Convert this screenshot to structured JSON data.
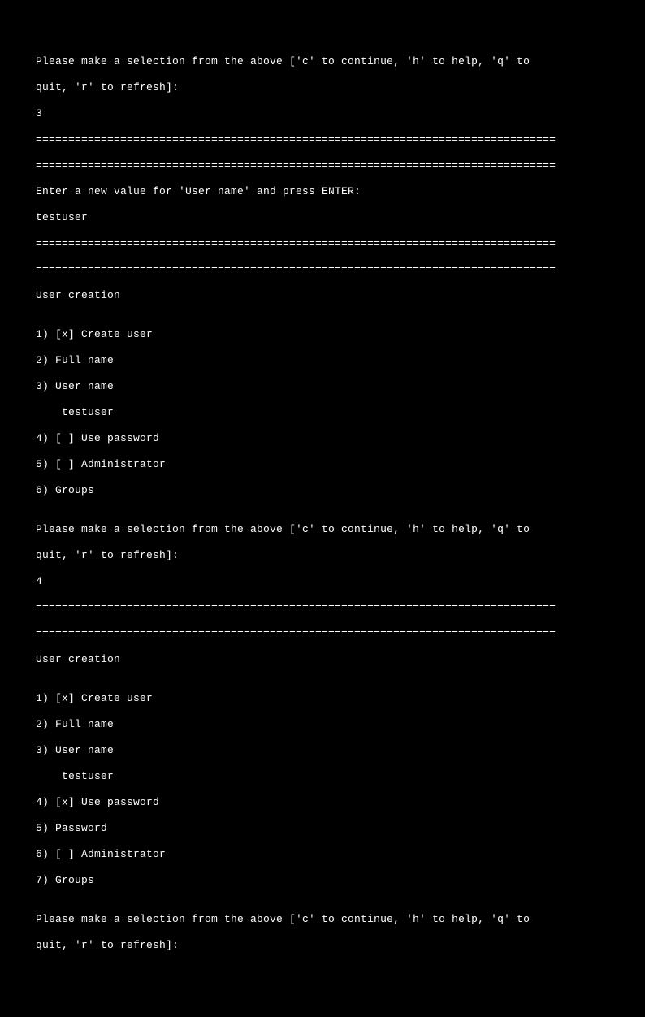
{
  "colors": {
    "bg": "#000000",
    "fg": "#ffffff"
  },
  "divider": "================================================================================",
  "blank": "",
  "menu1": {
    "prompt_line1": "Please make a selection from the above ['c' to continue, 'h' to help, 'q' to",
    "prompt_line2": "quit, 'r' to refresh]:",
    "input": "3"
  },
  "enter_value": {
    "prompt": "Enter a new value for 'User name' and press ENTER:",
    "input": "testuser"
  },
  "menu2": {
    "title": "User creation",
    "items": [
      "1) [x] Create user",
      "2) Full name",
      "3) User name",
      "    testuser",
      "4) [ ] Use password",
      "5) [ ] Administrator",
      "6) Groups"
    ],
    "prompt_line1": "Please make a selection from the above ['c' to continue, 'h' to help, 'q' to",
    "prompt_line2": "quit, 'r' to refresh]:",
    "input": "4"
  },
  "menu3": {
    "title": "User creation",
    "items": [
      "1) [x] Create user",
      "2) Full name",
      "3) User name",
      "    testuser",
      "4) [x] Use password",
      "5) Password",
      "6) [ ] Administrator",
      "7) Groups"
    ],
    "prompt_line1": "Please make a selection from the above ['c' to continue, 'h' to help, 'q' to",
    "prompt_line2": "quit, 'r' to refresh]:"
  }
}
